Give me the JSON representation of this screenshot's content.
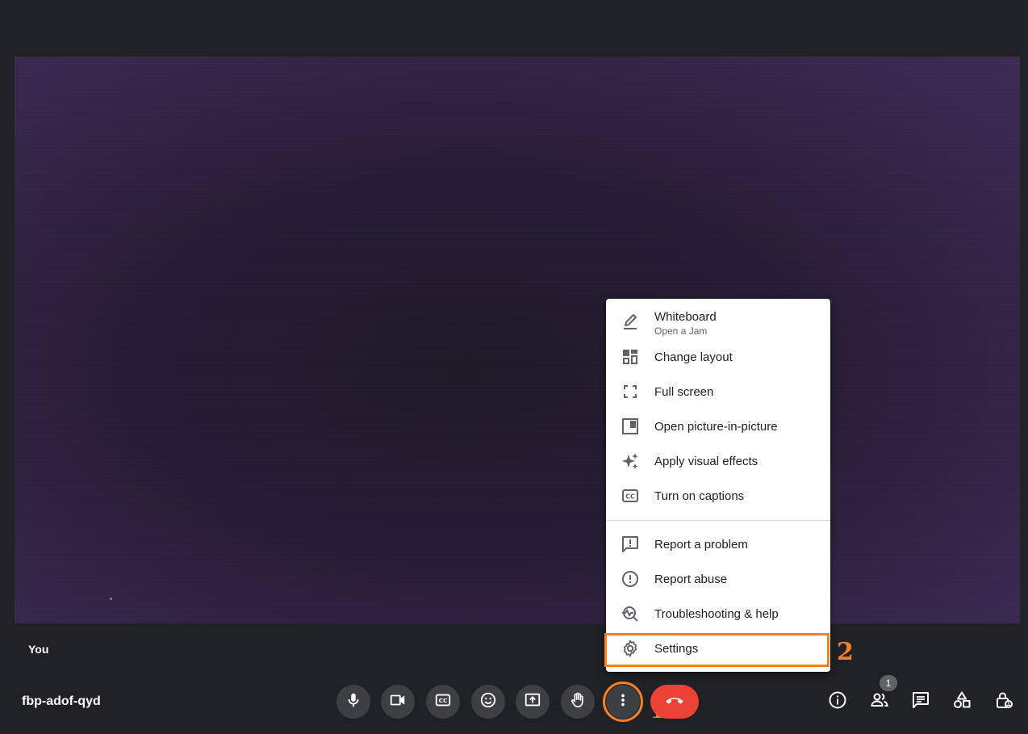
{
  "self_label": "You",
  "meeting_code": "fbp-adof-qyd",
  "menu": {
    "whiteboard": {
      "label": "Whiteboard",
      "sub": "Open a Jam"
    },
    "change_layout": "Change layout",
    "full_screen": "Full screen",
    "picture_in_picture": "Open picture-in-picture",
    "visual_effects": "Apply visual effects",
    "captions": "Turn on captions",
    "report_problem": "Report a problem",
    "report_abuse": "Report abuse",
    "troubleshooting": "Troubleshooting & help",
    "settings": "Settings"
  },
  "annotations": {
    "step1": "1",
    "step2": "2"
  },
  "people_count": "1",
  "colors": {
    "accent_annotation": "#f58025",
    "end_call": "#ea4335",
    "toolbar_button": "#3c4043"
  }
}
